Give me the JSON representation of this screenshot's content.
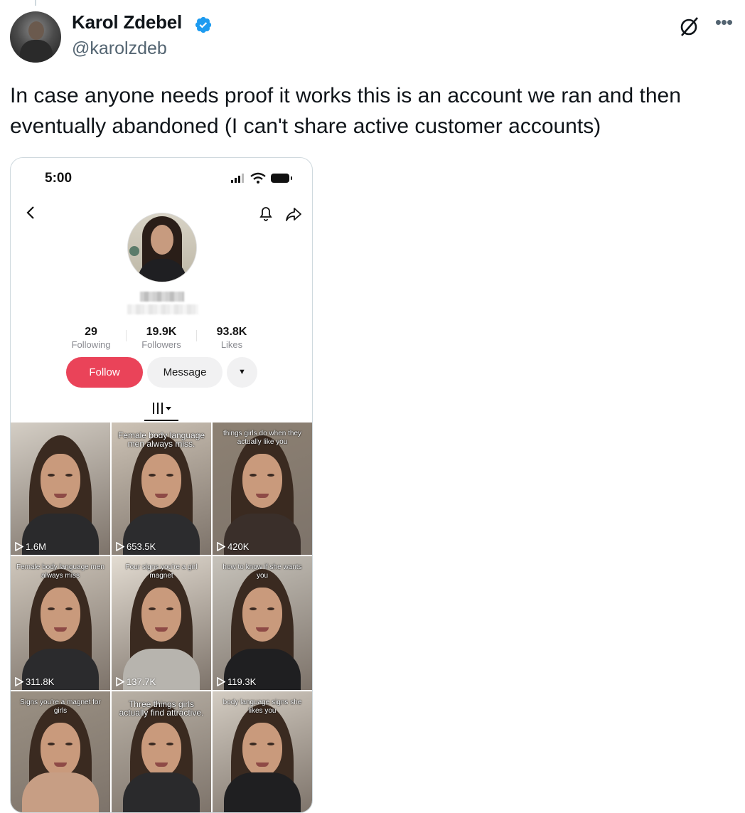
{
  "author": {
    "name": "Karol Zdebel",
    "handle": "@karolzdeb",
    "verified_color": "#1d9bf0"
  },
  "icons": {
    "grok": "grok-icon",
    "more": "more-icon"
  },
  "tweet": {
    "text": "In case anyone needs proof it works this is an account we ran and then eventually abandoned (I can't share active customer accounts)"
  },
  "screenshot": {
    "status_time": "5:00",
    "stats": [
      {
        "value": "29",
        "label": "Following"
      },
      {
        "value": "19.9K",
        "label": "Followers"
      },
      {
        "value": "93.8K",
        "label": "Likes"
      }
    ],
    "buttons": {
      "follow": "Follow",
      "message": "Message"
    },
    "accent": "#ea4359",
    "videos": [
      {
        "caption": "",
        "views": "1.6M"
      },
      {
        "caption": "Female body language men always miss.",
        "views": "653.5K"
      },
      {
        "caption": "things girls do when they actually like you",
        "views": "420K"
      },
      {
        "caption": "Female body language men always miss",
        "views": "311.8K"
      },
      {
        "caption": "Four signs you're a girl magnet",
        "views": "137.7K"
      },
      {
        "caption": "how to know if she wants you",
        "views": "119.3K"
      },
      {
        "caption": "Signs you're a magnet for girls",
        "views": ""
      },
      {
        "caption": "Three things girls actually find attractive.",
        "views": ""
      },
      {
        "caption": "body language signs she likes you",
        "views": ""
      }
    ]
  }
}
